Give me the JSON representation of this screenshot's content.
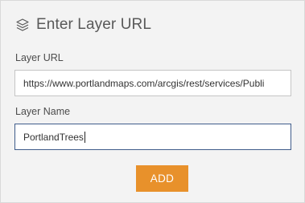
{
  "header": {
    "title": "Enter Layer URL",
    "icon": "layers-icon"
  },
  "form": {
    "url_label": "Layer URL",
    "url_value": "https://www.portlandmaps.com/arcgis/rest/services/Publi",
    "name_label": "Layer Name",
    "name_value": "PortlandTrees",
    "add_label": "ADD"
  },
  "colors": {
    "panel_bg": "#f3f3f3",
    "accent_button": "#e8912b",
    "focus_border": "#3f5c8a"
  }
}
